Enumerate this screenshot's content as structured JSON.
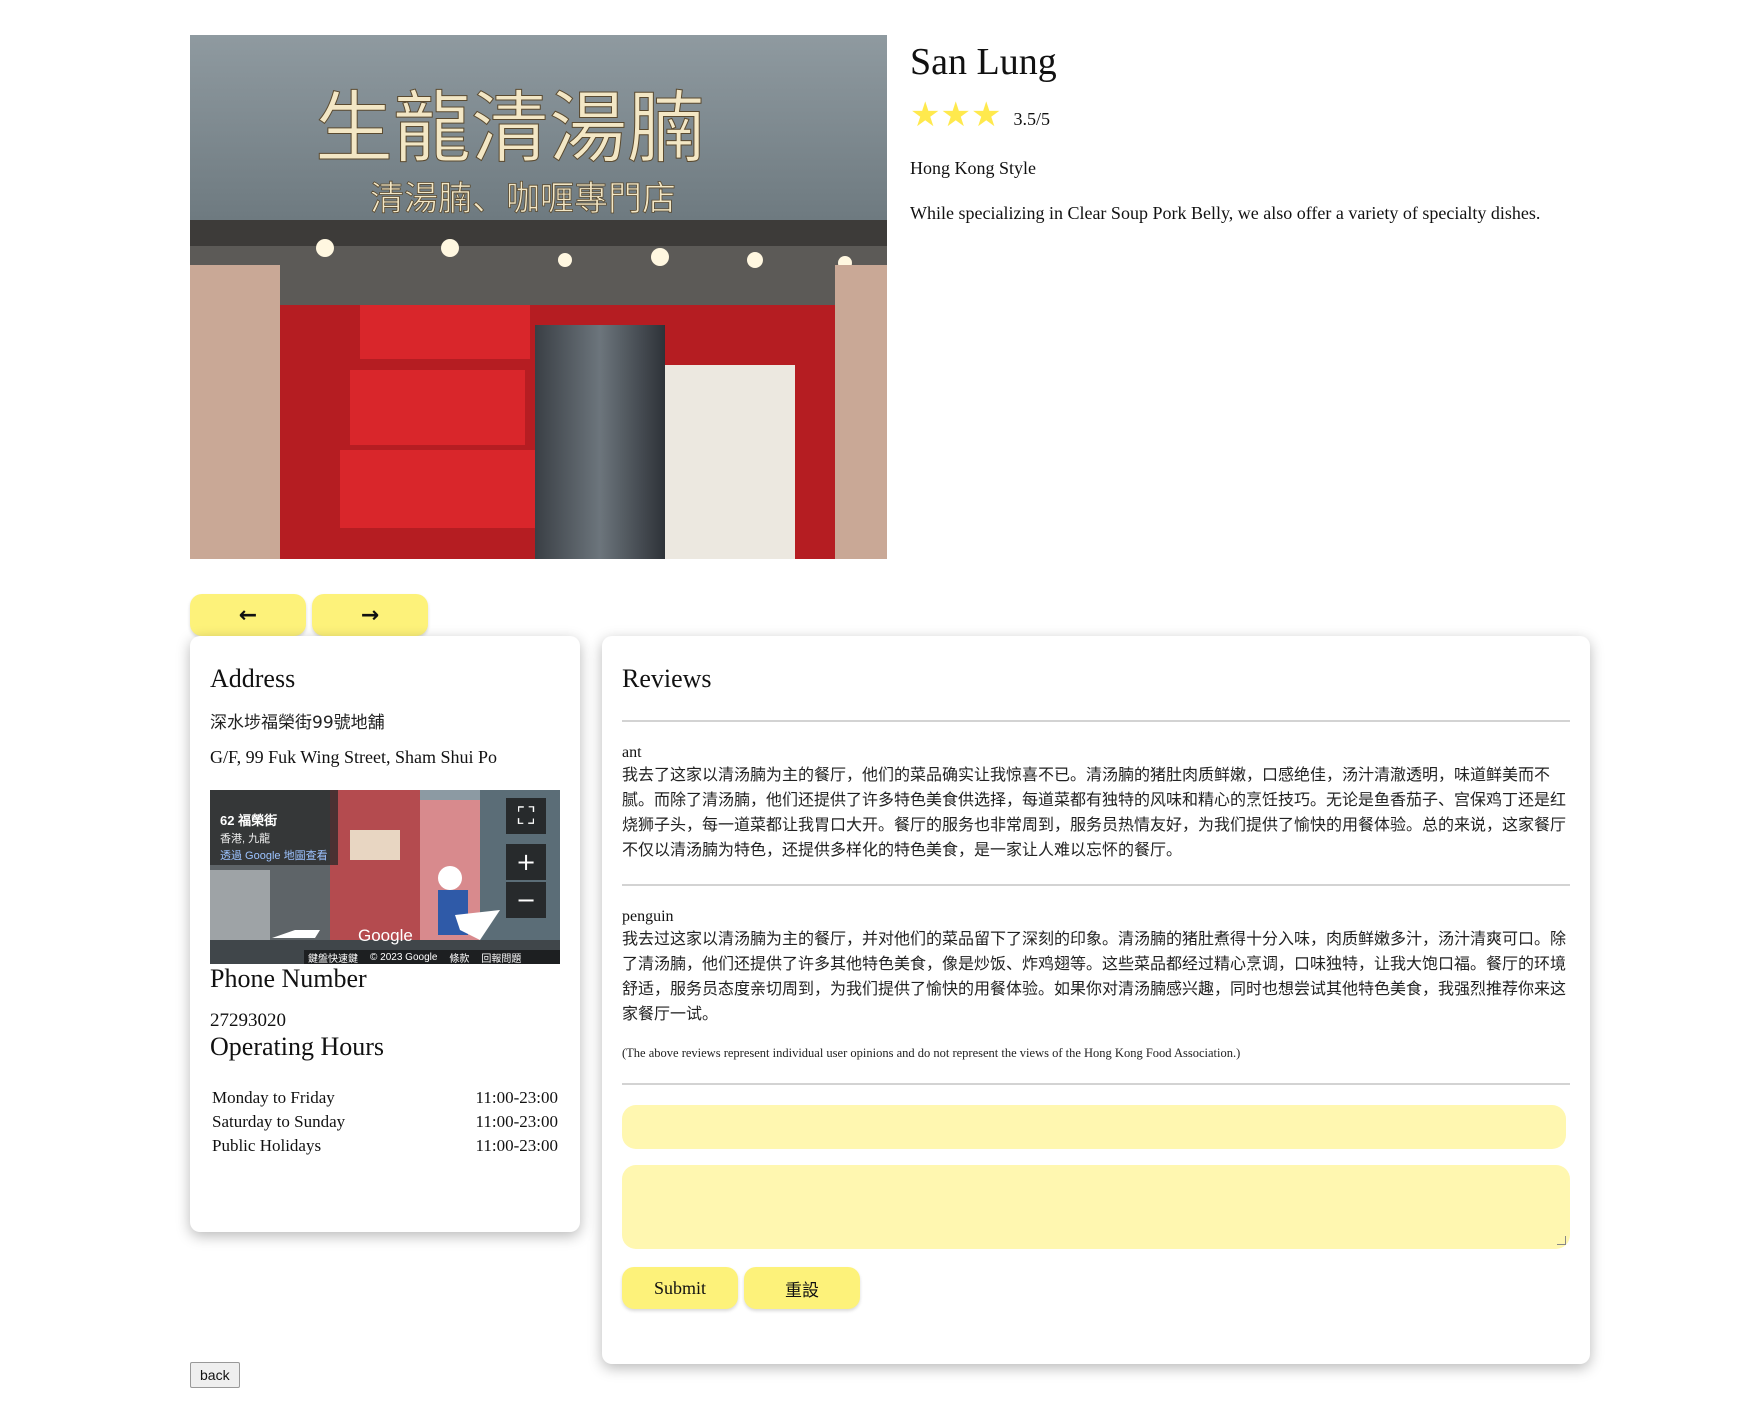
{
  "restaurant": {
    "name": "San Lung",
    "stars": "★★★",
    "rating_text": "3.5/5",
    "cuisine": "Hong Kong Style",
    "description": "While specializing in Clear Soup Pork Belly, we also offer a variety of specialty dishes.",
    "photo_sign_text": "生龍清湯腩",
    "photo_sub_text": "清湯腩、咖喱專門店"
  },
  "carousel": {
    "prev_icon": "←",
    "next_icon": "→"
  },
  "address": {
    "heading": "Address",
    "zh": "深水埗福榮街99號地舖",
    "en": "G/F, 99 Fuk Wing Street, Sham Shui Po"
  },
  "streetview": {
    "title": "62 福榮街",
    "subtitle": "香港, 九龍",
    "link": "透過 Google 地圖查看",
    "brand": "Google",
    "footer": [
      "鍵盤快速鍵",
      "© 2023 Google",
      "條款",
      "回報問題"
    ],
    "icons": [
      "fullscreen-icon",
      "zoom-in-icon",
      "zoom-out-icon",
      "map-pin-icon"
    ]
  },
  "phone": {
    "heading": "Phone Number",
    "number": "27293020"
  },
  "hours": {
    "heading": "Operating Hours",
    "rows": [
      {
        "day": "Monday to Friday",
        "time": "11:00-23:00"
      },
      {
        "day": "Saturday to Sunday",
        "time": "11:00-23:00"
      },
      {
        "day": "Public Holidays",
        "time": "11:00-23:00"
      }
    ]
  },
  "reviews": {
    "heading": "Reviews",
    "items": [
      {
        "user": "ant",
        "text": "我去了这家以清汤腩为主的餐厅，他们的菜品确实让我惊喜不已。清汤腩的猪肚肉质鲜嫩，口感绝佳，汤汁清澈透明，味道鲜美而不腻。而除了清汤腩，他们还提供了许多特色美食供选择，每道菜都有独特的风味和精心的烹饪技巧。无论是鱼香茄子、宫保鸡丁还是红烧狮子头，每一道菜都让我胃口大开。餐厅的服务也非常周到，服务员热情友好，为我们提供了愉快的用餐体验。总的来说，这家餐厅不仅以清汤腩为特色，还提供多样化的特色美食，是一家让人难以忘怀的餐厅。"
      },
      {
        "user": "penguin",
        "text": "我去过这家以清汤腩为主的餐厅，并对他们的菜品留下了深刻的印象。清汤腩的猪肚煮得十分入味，肉质鲜嫩多汁，汤汁清爽可口。除了清汤腩，他们还提供了许多其他特色美食，像是炒饭、炸鸡翅等。这些菜品都经过精心烹调，口味独特，让我大饱口福。餐厅的环境舒适，服务员态度亲切周到，为我们提供了愉快的用餐体验。如果你对清汤腩感兴趣，同时也想尝试其他特色美食，我强烈推荐你来这家餐厅一试。"
      }
    ],
    "disclaimer": "(The above reviews represent individual user opinions and do not represent the views of the Hong Kong Food Association.)"
  },
  "form": {
    "name_value": "",
    "comment_value": "",
    "submit_label": "Submit",
    "reset_label": "重設"
  },
  "back_label": "back",
  "colors": {
    "accent_yellow": "#fdf27a",
    "input_yellow": "#fff7b0",
    "star_yellow": "#ffe94d"
  }
}
